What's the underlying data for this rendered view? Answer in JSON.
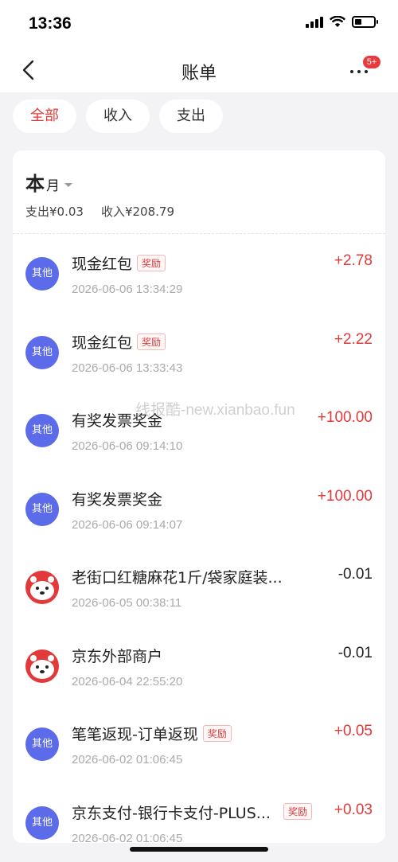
{
  "status": {
    "time": "13:36"
  },
  "nav": {
    "title": "账单",
    "badge": "5+"
  },
  "filters": [
    {
      "label": "全部",
      "active": true
    },
    {
      "label": "收入",
      "active": false
    },
    {
      "label": "支出",
      "active": false
    }
  ],
  "month": {
    "main": "本",
    "sub": "月"
  },
  "summary": {
    "expense": "支出¥0.03",
    "income": "收入¥208.79"
  },
  "transactions": [
    {
      "avatar": "其他",
      "avatar_type": "other",
      "title": "现金红包",
      "tag": "奖励",
      "time": "2026-06-06 13:34:29",
      "amount": "+2.78",
      "sign": "pos"
    },
    {
      "avatar": "其他",
      "avatar_type": "other",
      "title": "现金红包",
      "tag": "奖励",
      "time": "2026-06-06 13:33:43",
      "amount": "+2.22",
      "sign": "pos"
    },
    {
      "avatar": "其他",
      "avatar_type": "other",
      "title": "有奖发票奖金",
      "tag": "",
      "time": "2026-06-06 09:14:10",
      "amount": "+100.00",
      "sign": "pos"
    },
    {
      "avatar": "其他",
      "avatar_type": "other",
      "title": "有奖发票奖金",
      "tag": "",
      "time": "2026-06-06 09:14:07",
      "amount": "+100.00",
      "sign": "pos"
    },
    {
      "avatar": "",
      "avatar_type": "jd",
      "title": "老街口红糖麻花1斤/袋家庭装...",
      "tag": "",
      "time": "2026-06-05 00:38:11",
      "amount": "-0.01",
      "sign": "neg"
    },
    {
      "avatar": "",
      "avatar_type": "jd",
      "title": "京东外部商户",
      "tag": "",
      "time": "2026-06-04 22:55:20",
      "amount": "-0.01",
      "sign": "neg"
    },
    {
      "avatar": "其他",
      "avatar_type": "other",
      "title": "笔笔返现-订单返现",
      "tag": "奖励",
      "time": "2026-06-02 01:06:45",
      "amount": "+0.05",
      "sign": "pos"
    },
    {
      "avatar": "其他",
      "avatar_type": "other",
      "title": "京东支付-银行卡支付-PLUS...",
      "tag_right": "奖励",
      "time": "2026-06-02 01:06:45",
      "amount": "+0.03",
      "sign": "pos"
    }
  ],
  "watermark": "线报酷-new.xianbao.fun",
  "colors": {
    "accent": "#e2393b",
    "avatar_other": "#5b6bea"
  }
}
